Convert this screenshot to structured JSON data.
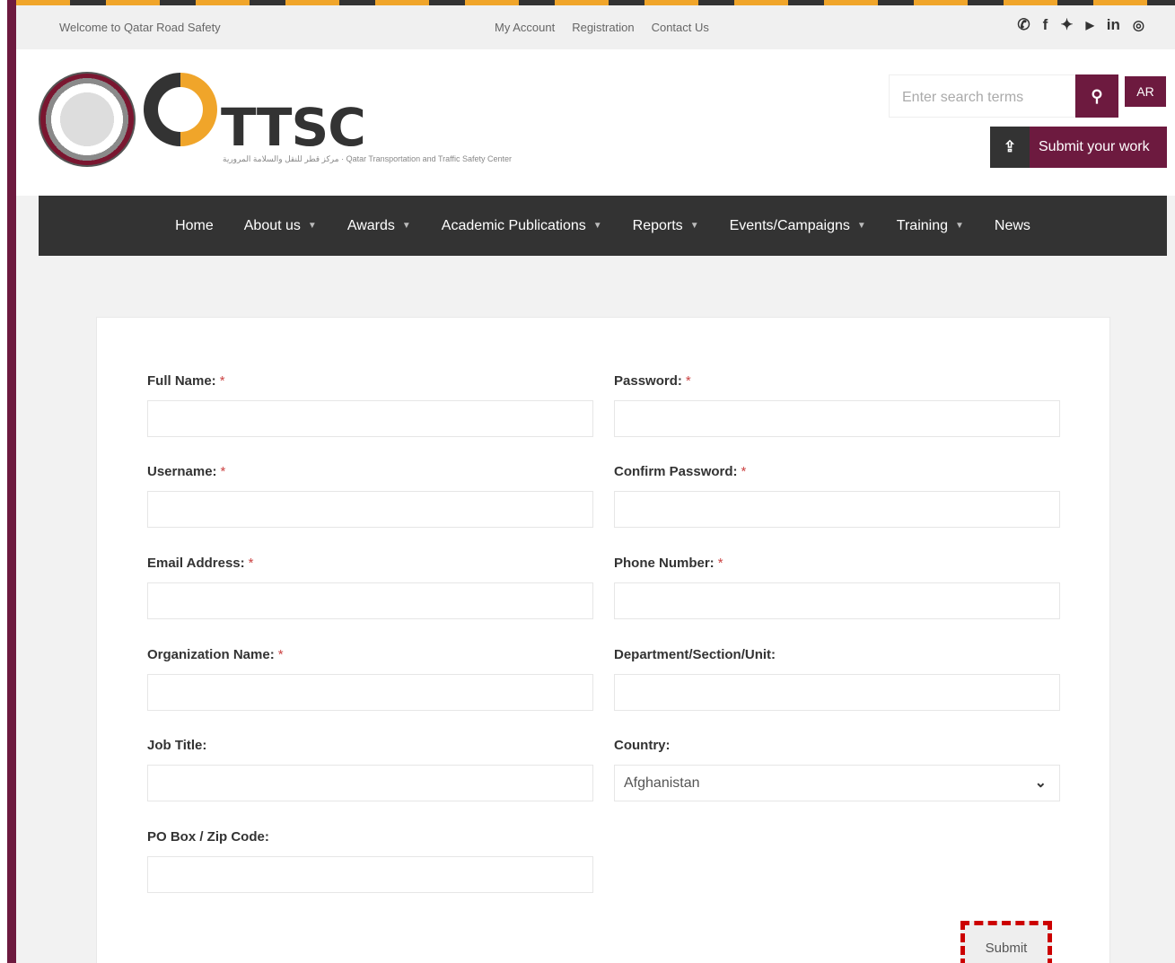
{
  "topbar": {
    "welcome": "Welcome to Qatar Road Safety",
    "links": [
      "My Account",
      "Registration",
      "Contact Us"
    ],
    "social": [
      "whatsapp-icon",
      "facebook-icon",
      "twitter-icon",
      "youtube-icon",
      "linkedin-icon",
      "instagram-icon"
    ]
  },
  "header": {
    "logo_text": "TTSC",
    "logo_sub": "مركز قطر للنقل والسلامة المرورية · Qatar Transportation and Traffic Safety Center",
    "search_placeholder": "Enter search terms",
    "ar_label": "AR",
    "submit_work_label": "Submit your work"
  },
  "nav": {
    "items": [
      {
        "label": "Home",
        "caret": false
      },
      {
        "label": "About us",
        "caret": true
      },
      {
        "label": "Awards",
        "caret": true
      },
      {
        "label": "Academic Publications",
        "caret": true
      },
      {
        "label": "Reports",
        "caret": true
      },
      {
        "label": "Events/Campaigns",
        "caret": true
      },
      {
        "label": "Training",
        "caret": true
      },
      {
        "label": "News",
        "caret": false
      }
    ]
  },
  "form": {
    "full_name": "Full Name:",
    "password": "Password:",
    "username": "Username:",
    "confirm_password": "Confirm Password:",
    "email": "Email Address:",
    "phone": "Phone Number:",
    "organization": "Organization Name:",
    "department": "Department/Section/Unit:",
    "job_title": "Job Title:",
    "country": "Country:",
    "country_value": "Afghanistan",
    "po_box": "PO Box / Zip Code:",
    "required_mark": "*",
    "submit_label": "Submit"
  },
  "colors": {
    "brand": "#6d1a3f",
    "nav_bg": "#333333",
    "accent": "#f0a52a"
  }
}
